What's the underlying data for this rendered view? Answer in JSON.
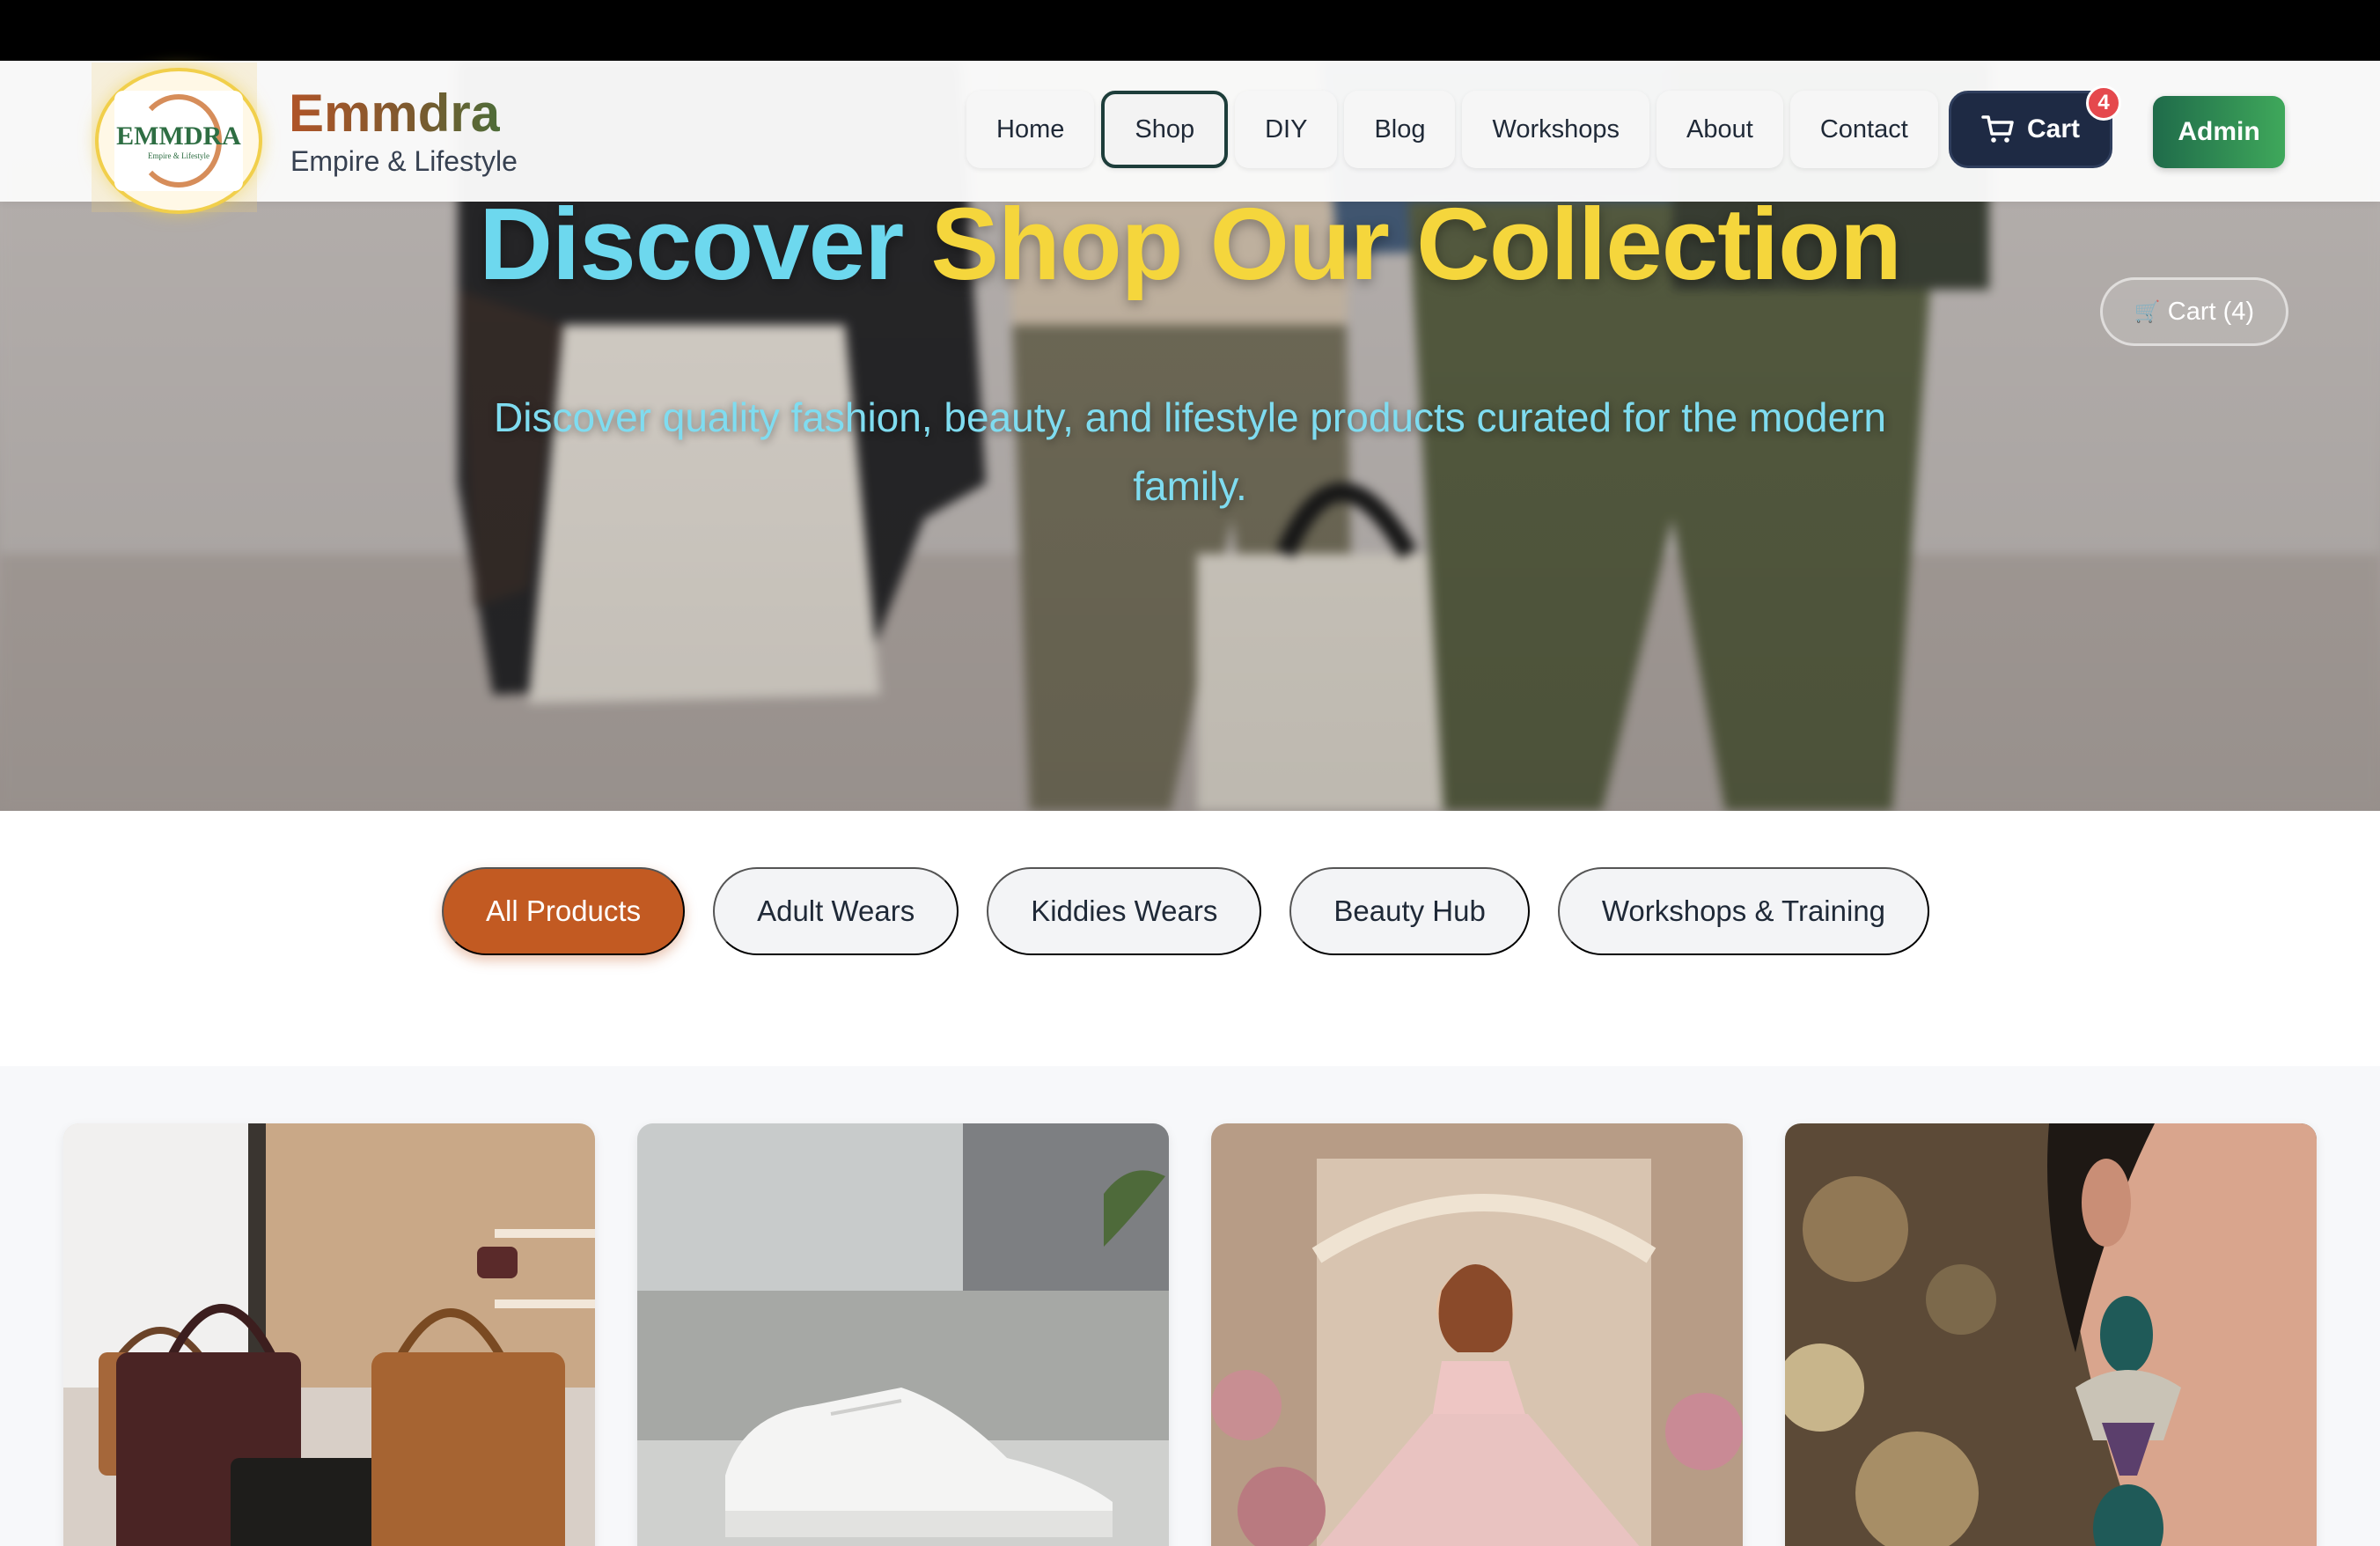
{
  "brand": {
    "name": "Emmdra",
    "tagline": "Empire & Lifestyle",
    "logo_text": "EMMDRA",
    "logo_subtext": "Empire & Lifestyle"
  },
  "nav": {
    "links": [
      {
        "label": "Home",
        "active": false
      },
      {
        "label": "Shop",
        "active": true
      },
      {
        "label": "DIY",
        "active": false
      },
      {
        "label": "Blog",
        "active": false
      },
      {
        "label": "Workshops",
        "active": false
      },
      {
        "label": "About",
        "active": false
      },
      {
        "label": "Contact",
        "active": false
      }
    ],
    "cart_label": "Cart",
    "cart_count": "4",
    "admin_label": "Admin"
  },
  "hero": {
    "title_part1": "Discover",
    "title_part2": "Shop Our Collection",
    "subtitle": "Discover quality fashion, beauty, and lifestyle products curated for the modern family.",
    "cart_button": "Cart (4)",
    "colors": {
      "title_part1": "#6dd8ee",
      "title_part2": "#f5d63c",
      "subtitle": "#7fdcf0"
    }
  },
  "filters": {
    "categories": [
      "All Products",
      "Adult Wears",
      "Kiddies Wears",
      "Beauty Hub",
      "Workshops & Training"
    ],
    "active_index": 0,
    "accent": "#c25a22"
  },
  "products": [
    {
      "image": "handbags"
    },
    {
      "image": "white-sneakers"
    },
    {
      "image": "girl-pink-dress"
    },
    {
      "image": "jeweled-earring"
    }
  ]
}
